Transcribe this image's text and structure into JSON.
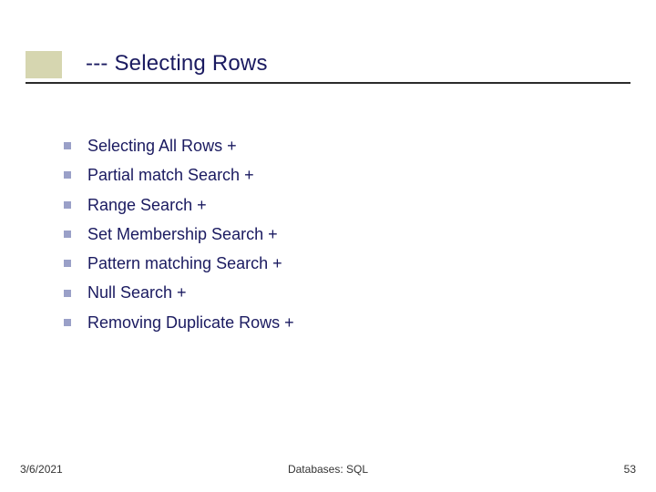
{
  "slide": {
    "title": "--- Selecting Rows",
    "bullets": [
      "Selecting All Rows +",
      "Partial match  Search +",
      "Range Search +",
      "Set Membership Search +",
      "Pattern matching Search +",
      "Null Search +",
      "Removing Duplicate Rows +"
    ]
  },
  "footer": {
    "date": "3/6/2021",
    "center": "Databases: SQL",
    "page": "53"
  }
}
